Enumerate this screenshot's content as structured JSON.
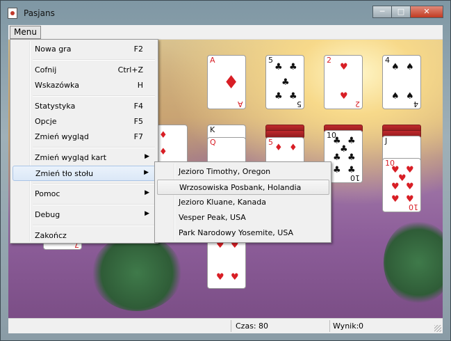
{
  "window": {
    "title": "Pasjans",
    "minimize": "─",
    "maximize": "□",
    "close": "✕"
  },
  "menubar": {
    "menu_label": "Menu"
  },
  "menu": {
    "items": [
      {
        "label": "Nowa gra",
        "shortcut": "F2"
      },
      {
        "label": "Cofnij",
        "shortcut": "Ctrl+Z"
      },
      {
        "label": "Wskazówka",
        "shortcut": "H"
      },
      {
        "label": "Statystyka",
        "shortcut": "F4"
      },
      {
        "label": "Opcje",
        "shortcut": "F5"
      },
      {
        "label": "Zmień wygląd",
        "shortcut": "F7"
      },
      {
        "label": "Zmień wygląd kart",
        "shortcut": ""
      },
      {
        "label": "Zmień tło stołu",
        "shortcut": ""
      },
      {
        "label": "Pomoc",
        "shortcut": ""
      },
      {
        "label": "Debug",
        "shortcut": ""
      },
      {
        "label": "Zakończ",
        "shortcut": ""
      }
    ],
    "submenu_arrow": "▶"
  },
  "submenu": {
    "items": [
      "Jezioro Timothy, Oregon",
      "Wrzosowiska Posbank, Holandia",
      "Jezioro Kluane, Kanada",
      "Vesper Peak, USA",
      "Park Narodowy Yosemite, USA"
    ]
  },
  "foundations": [
    {
      "rank": "A",
      "suit": "♦",
      "color": "red"
    },
    {
      "rank": "5",
      "suit": "♣",
      "color": "black"
    },
    {
      "rank": "2",
      "suit": "♥",
      "color": "red"
    },
    {
      "rank": "4",
      "suit": "♠",
      "color": "black"
    }
  ],
  "tableau": [
    {
      "rank": "K",
      "suit": "♥"
    },
    {
      "rank": "5",
      "suit": "♦"
    },
    {
      "rank": "10",
      "suit": "♣"
    },
    {
      "rank": "10",
      "suit": "♥"
    },
    {
      "rank": "Q",
      "suit": "♦"
    },
    {
      "rank": "J",
      "suit": "♠"
    },
    {
      "rank": "7",
      "suit": "♥"
    }
  ],
  "status": {
    "time_label": "Czas:",
    "time_value": "80",
    "score_label": "Wynik:",
    "score_value": "0"
  }
}
